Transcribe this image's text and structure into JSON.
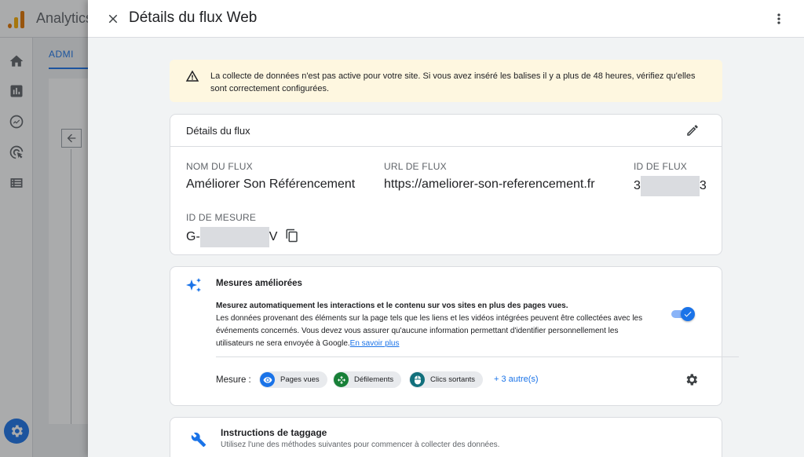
{
  "background": {
    "app_title": "Analytics",
    "tab_label": "ADMI"
  },
  "drawer": {
    "title": "Détails du flux Web"
  },
  "alert": {
    "text": "La collecte de données n'est pas active pour votre site. Si vous avez inséré les balises il y a plus de 48 heures, vérifiez qu'elles sont correctement configurées."
  },
  "stream_details": {
    "title": "Détails du flux",
    "name_label": "NOM DU FLUX",
    "name_value": "Améliorer Son Référencement",
    "url_label": "URL DE FLUX",
    "url_value": "https://ameliorer-son-referencement.fr",
    "id_label": "ID DE FLUX",
    "id_prefix": "3",
    "id_suffix": "3",
    "measure_label": "ID DE MESURE",
    "measure_prefix": "G-",
    "measure_suffix": "V"
  },
  "enhanced": {
    "title": "Mesures améliorées",
    "desc_strong": "Mesurez automatiquement les interactions et le contenu sur vos sites en plus des pages vues.",
    "desc_body": "Les données provenant des éléments sur la page tels que les liens et les vidéos intégrées peuvent être collectées avec les événements concernés. Vous devez vous assurer qu'aucune information permettant d'identifier personnellement les utilisateurs ne sera envoyée à Google.",
    "learn_more": "En savoir plus",
    "toggle_on": true,
    "mesure_label": "Mesure :",
    "chips": [
      {
        "label": "Pages vues",
        "color": "#1a73e8",
        "icon": "eye-icon"
      },
      {
        "label": "Défilements",
        "color": "#188038",
        "icon": "move-icon"
      },
      {
        "label": "Clics sortants",
        "color": "#12707c",
        "icon": "mouse-icon"
      }
    ],
    "more_link": "+ 3 autre(s)"
  },
  "tagging": {
    "title": "Instructions de taggage",
    "subtitle": "Utilisez l'une des méthodes suivantes pour commencer à collecter des données."
  },
  "colors": {
    "accent": "#1a73e8",
    "alert_bg": "#fef7e0",
    "chip_scroll": "#188038",
    "chip_click": "#12707c"
  }
}
